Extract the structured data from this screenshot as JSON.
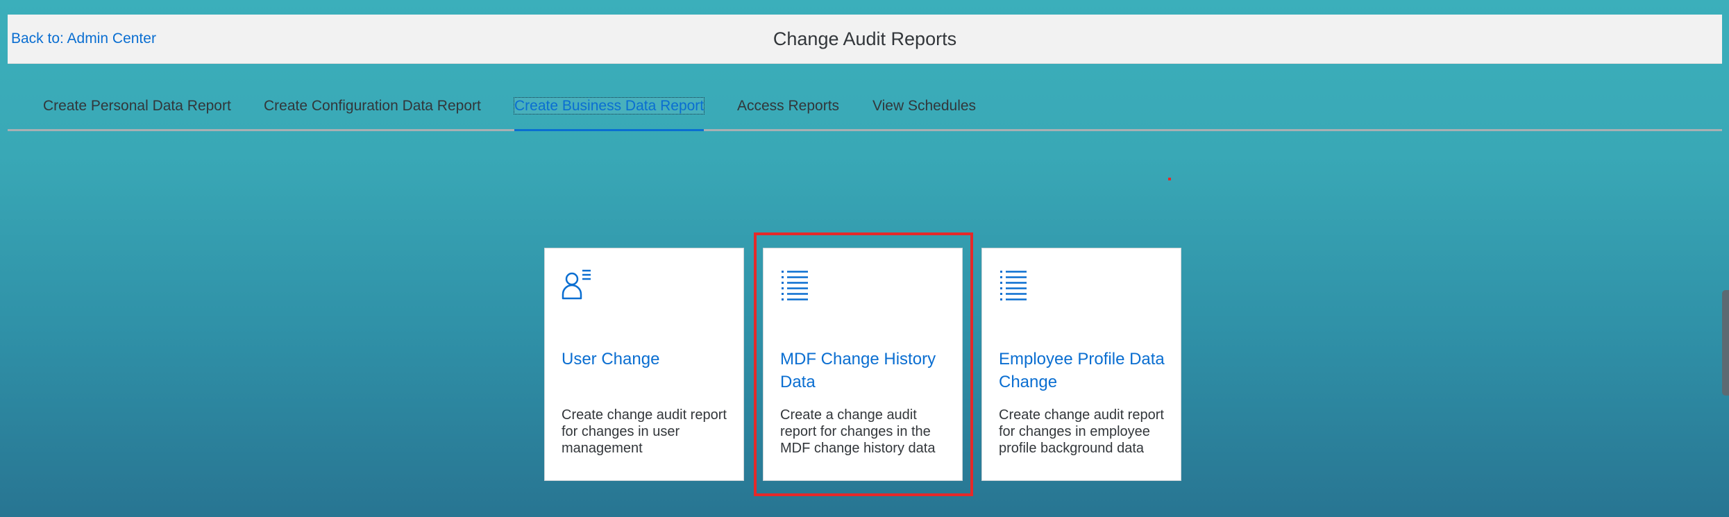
{
  "header": {
    "back_link": "Back to: Admin Center",
    "title": "Change Audit Reports"
  },
  "tabs": [
    {
      "label": "Create Personal Data Report",
      "selected": false
    },
    {
      "label": "Create Configuration Data Report",
      "selected": false
    },
    {
      "label": "Create Business Data Report",
      "selected": true
    },
    {
      "label": "Access Reports",
      "selected": false
    },
    {
      "label": "View Schedules",
      "selected": false
    }
  ],
  "cards": [
    {
      "icon": "user-list-icon",
      "title": "User Change",
      "description": "Create change audit report for changes in user management"
    },
    {
      "icon": "list-icon",
      "title": "MDF Change History Data",
      "description": "Create a change audit report for changes in the MDF change history data",
      "highlighted": true
    },
    {
      "icon": "list-icon",
      "title": "Employee Profile Data Change",
      "description": "Create change audit report for changes in employee profile background data"
    }
  ],
  "colors": {
    "accent": "#0a6ed1",
    "highlight": "#e52929",
    "header_bg": "#f2f2f2",
    "text": "#32363a"
  }
}
